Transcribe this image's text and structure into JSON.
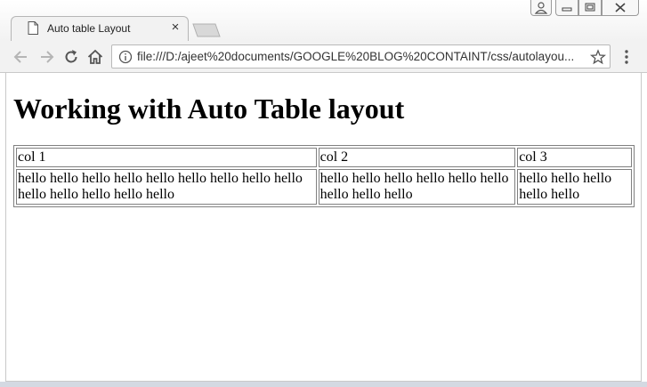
{
  "browser": {
    "tab_title": "Auto table Layout",
    "tab_close": "×",
    "url": "file:///D:/ajeet%20documents/GOOGLE%20BLOG%20CONTAINT/css/autolayou..."
  },
  "page": {
    "heading": "Working with Auto Table layout",
    "table": {
      "headers": [
        "col 1",
        "col 2",
        "col 3"
      ],
      "row": [
        "hello hello hello hello hello hello hello hello hello hello hello hello hello hello",
        "hello hello hello hello hello hello hello hello hello",
        "hello hello hello hello hello"
      ]
    }
  }
}
